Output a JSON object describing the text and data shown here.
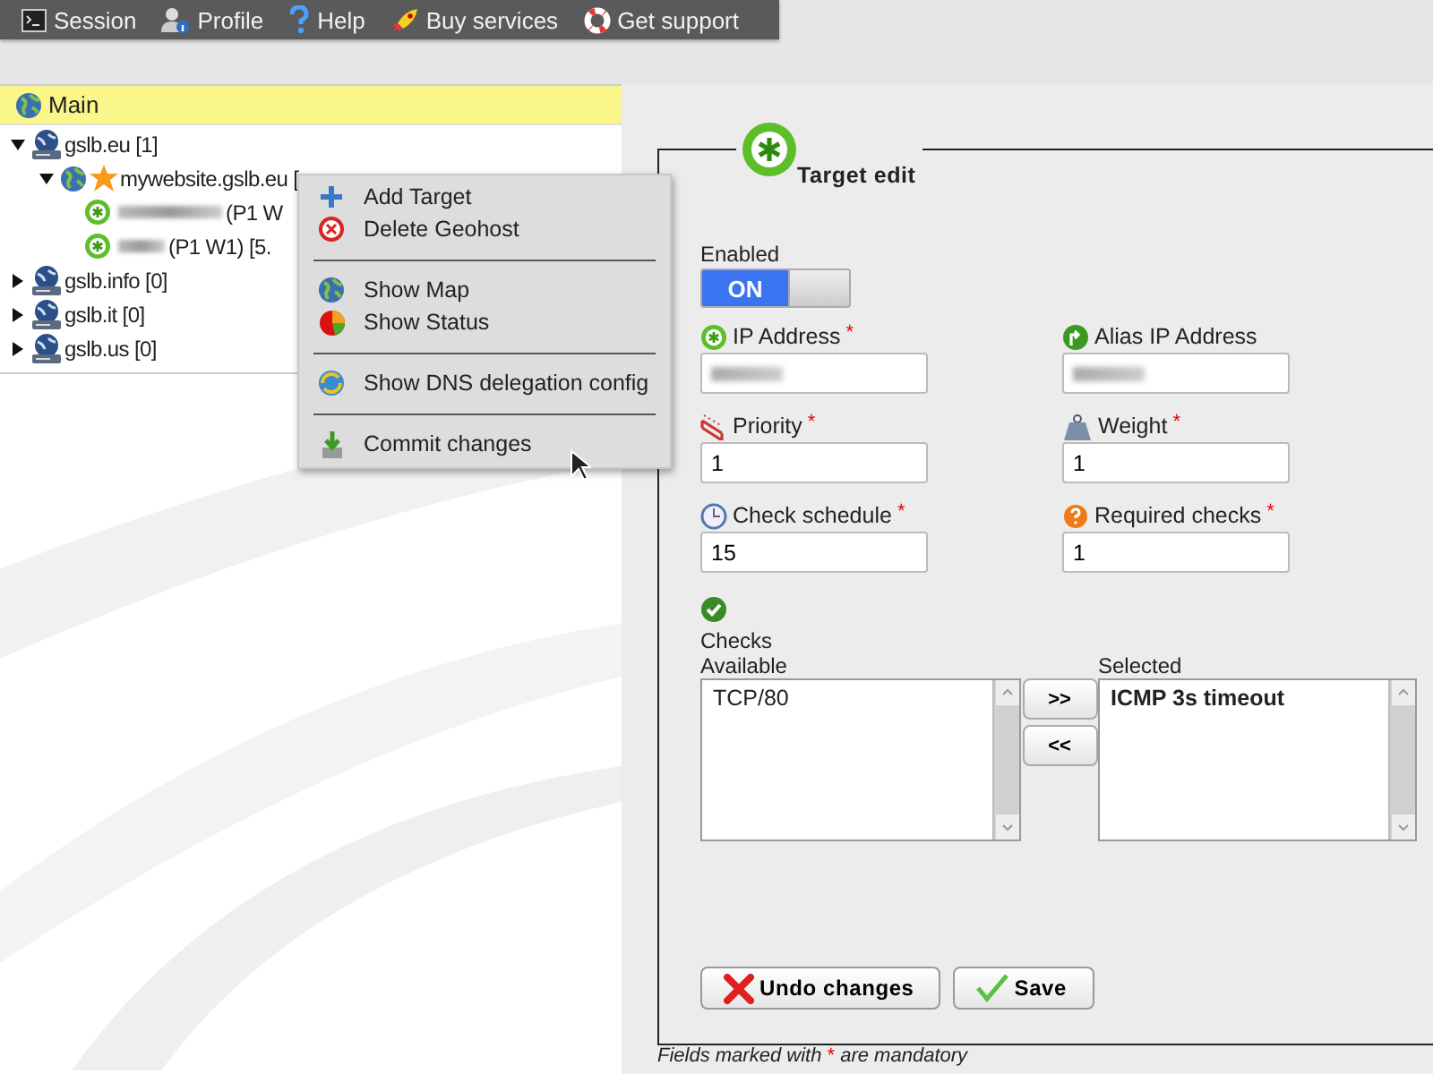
{
  "toolbar": [
    {
      "label": "Session"
    },
    {
      "label": "Profile"
    },
    {
      "label": "Help"
    },
    {
      "label": "Buy services"
    },
    {
      "label": "Get support"
    }
  ],
  "tree": {
    "header": "Main",
    "nodes": [
      {
        "kind": "domain",
        "label": "gslb.eu [1]",
        "expanded": true,
        "children": [
          {
            "kind": "geohost",
            "label": "mywebsite.gslb.eu [",
            "expanded": true,
            "children": [
              {
                "kind": "target",
                "label": "(P1 W"
              },
              {
                "kind": "target",
                "label": "(P1 W1) [5."
              }
            ]
          }
        ]
      },
      {
        "kind": "domain",
        "label": "gslb.info [0]",
        "expanded": false
      },
      {
        "kind": "domain",
        "label": "gslb.it [0]",
        "expanded": false
      },
      {
        "kind": "domain",
        "label": "gslb.us [0]",
        "expanded": false
      }
    ]
  },
  "context_menu": [
    {
      "kind": "item",
      "label": "Add Target"
    },
    {
      "kind": "item",
      "label": "Delete Geohost"
    },
    {
      "kind": "separator"
    },
    {
      "kind": "item",
      "label": "Show Map"
    },
    {
      "kind": "item",
      "label": "Show Status"
    },
    {
      "kind": "separator"
    },
    {
      "kind": "item",
      "label": "Show DNS delegation config"
    },
    {
      "kind": "separator"
    },
    {
      "kind": "item",
      "label": "Commit changes"
    }
  ],
  "form": {
    "title": "Target edit",
    "required_mark": "*",
    "enabled": {
      "label": "Enabled",
      "state_label": "ON",
      "on": true
    },
    "fields": [
      {
        "label": "IP Address",
        "required": true,
        "redacted": true
      },
      {
        "label": "Alias IP Address",
        "required": false,
        "redacted": true
      },
      {
        "label": "Priority",
        "required": true,
        "value": "1"
      },
      {
        "label": "Weight",
        "required": true,
        "value": "1"
      },
      {
        "label": "Check schedule",
        "required": true,
        "value": "15"
      },
      {
        "label": "Required checks",
        "required": true,
        "value": "1"
      }
    ],
    "checks": {
      "label": "Checks",
      "available": {
        "label": "Available",
        "items": [
          "TCP/80"
        ]
      },
      "selected": {
        "label": "Selected",
        "items": [
          "ICMP 3s timeout"
        ]
      },
      "add_button": ">>",
      "remove_button": "<<"
    },
    "buttons": [
      {
        "kind": "undo",
        "label": "Undo changes"
      },
      {
        "kind": "save",
        "label": "Save"
      }
    ],
    "note": {
      "before": "Fields marked with",
      "after": "are mandatory"
    }
  }
}
